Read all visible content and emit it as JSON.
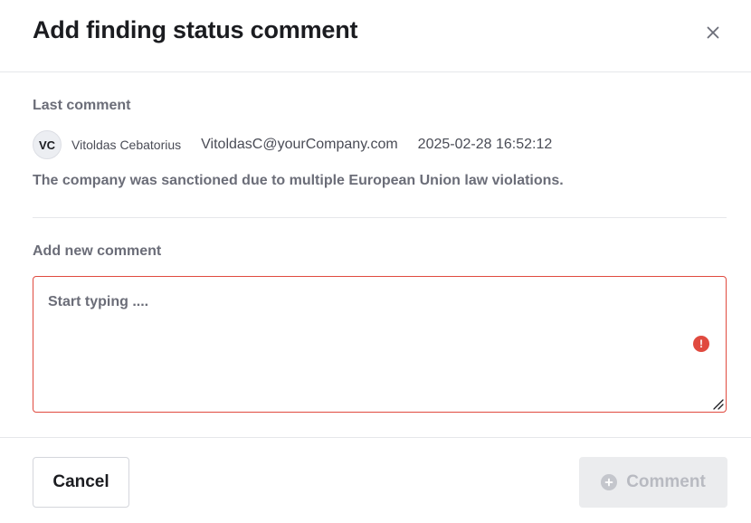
{
  "dialog": {
    "title": "Add finding status comment",
    "close_icon": "close-icon"
  },
  "last_comment": {
    "section_label": "Last comment",
    "avatar_initials": "VC",
    "author": "Vitoldas Cebatorius",
    "email": "VitoldasC@yourCompany.com",
    "timestamp": "2025-02-28 16:52:12",
    "text": "The company was sanctioned due to multiple European Union law violations."
  },
  "new_comment": {
    "section_label": "Add new comment",
    "value": "",
    "placeholder": "Start typing ....",
    "error_icon": "error-icon",
    "error_color": "#e04a3f"
  },
  "footer": {
    "cancel_label": "Cancel",
    "comment_label": "Comment",
    "comment_icon": "plus-circle-icon",
    "comment_disabled": true
  }
}
